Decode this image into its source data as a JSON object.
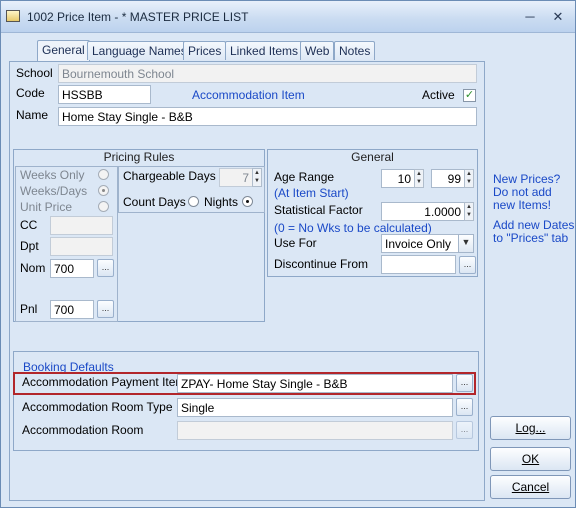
{
  "window": {
    "title": "1002 Price Item - * MASTER PRICE LIST",
    "minimize": "─",
    "close": "✕"
  },
  "tabs": [
    {
      "label": "General"
    },
    {
      "label": "Language Names"
    },
    {
      "label": "Prices"
    },
    {
      "label": "Linked Items"
    },
    {
      "label": "Web"
    },
    {
      "label": "Notes"
    }
  ],
  "general": {
    "school_label": "School",
    "school_value": "Bournemouth School",
    "code_label": "Code",
    "code_value": "HSSBB",
    "item_type": "Accommodation Item",
    "active_label": "Active",
    "active_check": "✓",
    "name_label": "Name",
    "name_value": "Home Stay Single - B&B"
  },
  "pricing_rules": {
    "title": "Pricing Rules",
    "weeks_only": "Weeks Only",
    "weeks_days": "Weeks/Days",
    "unit_price": "Unit Price",
    "chargeable_days_label": "Chargeable Days",
    "chargeable_days_value": "7",
    "count_days_label": "Count Days",
    "nights_label": "Nights",
    "cc_label": "CC",
    "dpt_label": "Dpt",
    "nom_label": "Nom",
    "nom_value": "700",
    "pnl_label": "Pnl",
    "pnl_value": "700",
    "dots": "..."
  },
  "general_box": {
    "title": "General",
    "age_range_label": "Age Range",
    "age_min": "10",
    "age_max": "99",
    "at_item_start": "(At Item Start)",
    "statistical_factor_label": "Statistical Factor",
    "statistical_factor_value": "1.0000",
    "zero_note": "(0 = No  Wks to be calculated)",
    "use_for_label": "Use For",
    "use_for_value": "Invoice Only",
    "discontinue_from_label": "Discontinue From",
    "discontinue_from_value": ""
  },
  "booking_defaults": {
    "title": "Booking Defaults",
    "payment_item_label": "Accommodation Payment Item",
    "payment_item_value": "ZPAY- Home Stay Single - B&B",
    "room_type_label": "Accommodation Room Type",
    "room_type_value": "Single",
    "room_label": "Accommodation Room",
    "room_value": ""
  },
  "side_notes": {
    "line1": "New Prices?",
    "line2": "Do not add",
    "line3": "new Items!",
    "line4": "Add new Dates",
    "line5": "to \"Prices\" tab"
  },
  "buttons": {
    "log": "Log...",
    "ok": "OK",
    "cancel": "Cancel"
  },
  "icons": {
    "dropdown": "▼",
    "spin_up": "▲",
    "spin_down": "▼"
  }
}
